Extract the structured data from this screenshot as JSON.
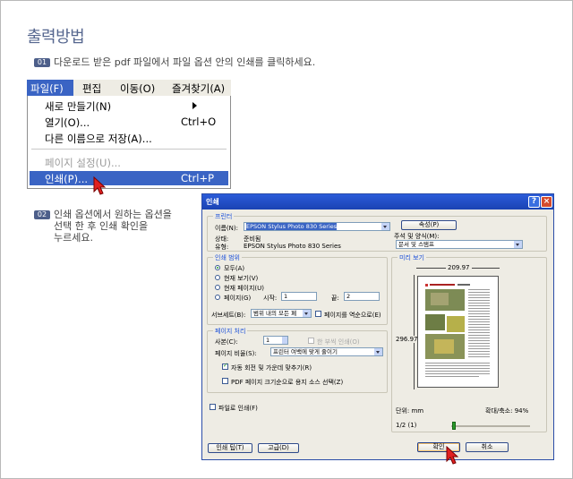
{
  "page_title": "출력방법",
  "step1": {
    "badge": "01",
    "text": "다운로드 받은 pdf 파일에서 파일 옵션 안의 인쇄를 클릭하세요."
  },
  "step2": {
    "badge": "02",
    "lines": [
      "인쇄 옵션에서 원하는 옵션을",
      "선택 한 후 인쇄 확인을",
      "누르세요."
    ]
  },
  "menubar": {
    "file": "파일(F)",
    "edit": "편집",
    "move": "이동(O)",
    "favorites": "즐겨찾기(A)"
  },
  "file_menu": {
    "new": "새로 만들기(N)",
    "open": "열기(O)...",
    "open_shortcut": "Ctrl+O",
    "save_as": "다른 이름으로 저장(A)...",
    "page_setup": "페이지 설정(U)...",
    "print": "인쇄(P)...",
    "print_shortcut": "Ctrl+P"
  },
  "dialog": {
    "title": "인쇄",
    "printer": {
      "group": "프린터",
      "name_label": "이름(N):",
      "name_value": "EPSON Stylus Photo 830 Series",
      "status_label": "상태:",
      "status_value": "준비됨",
      "type_label": "유형:",
      "type_value": "EPSON Stylus Photo 830 Series",
      "properties_button": "속성(P)",
      "comments_label": "주석 및 양식(M):",
      "comments_value": "문서 및 스탬프"
    },
    "range": {
      "group": "인쇄 범위",
      "all": "모두(A)",
      "current_view": "현재 보기(V)",
      "current_page": "현재 페이지(U)",
      "pages": "페이지(G)",
      "from_label": "시작:",
      "from_value": "1",
      "to_label": "끝:",
      "to_value": "2",
      "subset_label": "서브세트(B):",
      "subset_value": "범위 내의 모든 페",
      "reverse": "페이지를 역순으로(E)"
    },
    "handling": {
      "group": "페이지 처리",
      "copies_label": "사본(C):",
      "copies_value": "1",
      "collate": "한 부씩 인쇄(O)",
      "scaling_label": "페이지 비율(S):",
      "scaling_value": "프린터 여백에 맞게 줄이기",
      "auto_rotate": "자동 회전 및 가운데 맞추기(R)",
      "pdf_size": "PDF 페이지 크기순으로 용지 소스 선택(Z)"
    },
    "print_to_file": "파일로 인쇄(F)",
    "preview": {
      "group": "미리 보기",
      "width": "209.97",
      "height": "296.97",
      "unit": "단위: mm",
      "zoom": "확대/축소: 94%",
      "page_count": "1/2 (1)"
    },
    "tips_button": "인쇄 팁(T)",
    "advanced_button": "고급(D)",
    "ok_button": "확인",
    "cancel_button": "취소"
  }
}
